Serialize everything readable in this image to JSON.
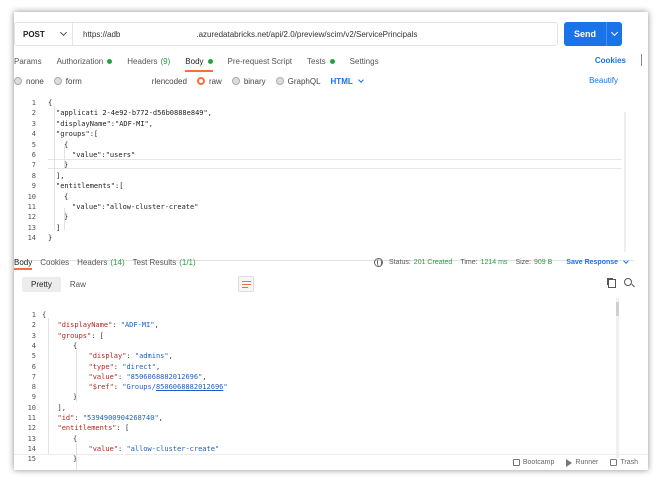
{
  "request": {
    "method": "POST",
    "url_prefix": "https://adb",
    "url_suffix": ".azuredatabricks.net/api/2.0/preview/scim/v2/ServicePrincipals",
    "send_label": "Send"
  },
  "req_tabs": {
    "params": "Params",
    "authorization": "Authorization",
    "headers": "Headers",
    "headers_count": "(9)",
    "body": "Body",
    "prerequest": "Pre-request Script",
    "tests": "Tests",
    "settings": "Settings",
    "cookies": "Cookies"
  },
  "body_types": {
    "none": "none",
    "form": "form",
    "urlencoded": "rlencoded",
    "raw": "raw",
    "binary": "binary",
    "graphql": "GraphQL",
    "html": "HTML",
    "beautify": "Beautify"
  },
  "request_body": [
    {
      "n": "1",
      "t": "{"
    },
    {
      "n": "2",
      "t": "\"applicati                    2-4e92-b772-d56b0888e849\","
    },
    {
      "n": "3",
      "t": "\"displayName\":\"ADF-MI\","
    },
    {
      "n": "4",
      "t": "\"groups\":["
    },
    {
      "n": "5",
      "t": "{"
    },
    {
      "n": "6",
      "t": "\"value\":\"users\""
    },
    {
      "n": "7",
      "t": "}"
    },
    {
      "n": "8",
      "t": "],"
    },
    {
      "n": "9",
      "t": "\"entitlements\":["
    },
    {
      "n": "10",
      "t": "{"
    },
    {
      "n": "11",
      "t": "\"value\":\"allow-cluster-create\""
    },
    {
      "n": "12",
      "t": "}"
    },
    {
      "n": "13",
      "t": "]"
    },
    {
      "n": "14",
      "t": "}"
    }
  ],
  "resp_tabs": {
    "body": "Body",
    "cookies": "Cookies",
    "headers": "Headers",
    "headers_count": "(14)",
    "tests": "Test Results",
    "tests_count": "(1/1)"
  },
  "status": {
    "status_label": "Status:",
    "status_value": "201 Created",
    "time_label": "Time:",
    "time_value": "1214 ms",
    "size_label": "Size:",
    "size_value": "909 B",
    "save_response": "Save Response"
  },
  "resp_tools": {
    "pretty": "Pretty",
    "raw": "Raw"
  },
  "response_body": [
    {
      "n": "1",
      "p": "{"
    },
    {
      "n": "2",
      "k": "\"displayName\"",
      "p": ": ",
      "s": "\"ADF-MI\"",
      "e": ","
    },
    {
      "n": "3",
      "k": "\"groups\"",
      "p": ": ["
    },
    {
      "n": "4",
      "p": "{"
    },
    {
      "n": "5",
      "k": "\"display\"",
      "p": ": ",
      "s": "\"admins\"",
      "e": ","
    },
    {
      "n": "6",
      "k": "\"type\"",
      "p": ": ",
      "s": "\"direct\"",
      "e": ","
    },
    {
      "n": "7",
      "k": "\"value\"",
      "p": ": ",
      "s": "\"8506068882012696\"",
      "e": ","
    },
    {
      "n": "8",
      "k": "\"$ref\"",
      "p": ": ",
      "s": "\"Groups/",
      "u": "8506068882012696",
      "s2": "\""
    },
    {
      "n": "9",
      "p": "}"
    },
    {
      "n": "10",
      "p": "],"
    },
    {
      "n": "11",
      "k": "\"id\"",
      "p": ": ",
      "s": "\"5394900904268740\"",
      "e": ","
    },
    {
      "n": "12",
      "k": "\"entitlements\"",
      "p": ": ["
    },
    {
      "n": "13",
      "p": "{"
    },
    {
      "n": "14",
      "k": "\"value\"",
      "p": ": ",
      "s": "\"allow-cluster-create\""
    },
    {
      "n": "15",
      "p": "}"
    }
  ],
  "footer": {
    "bootcamp": "Bootcamp",
    "runner": "Runner",
    "trash": "Trash"
  },
  "colors": {
    "accent": "#1a73e8",
    "tab_active": "#ff6c37",
    "success": "#25a244"
  }
}
